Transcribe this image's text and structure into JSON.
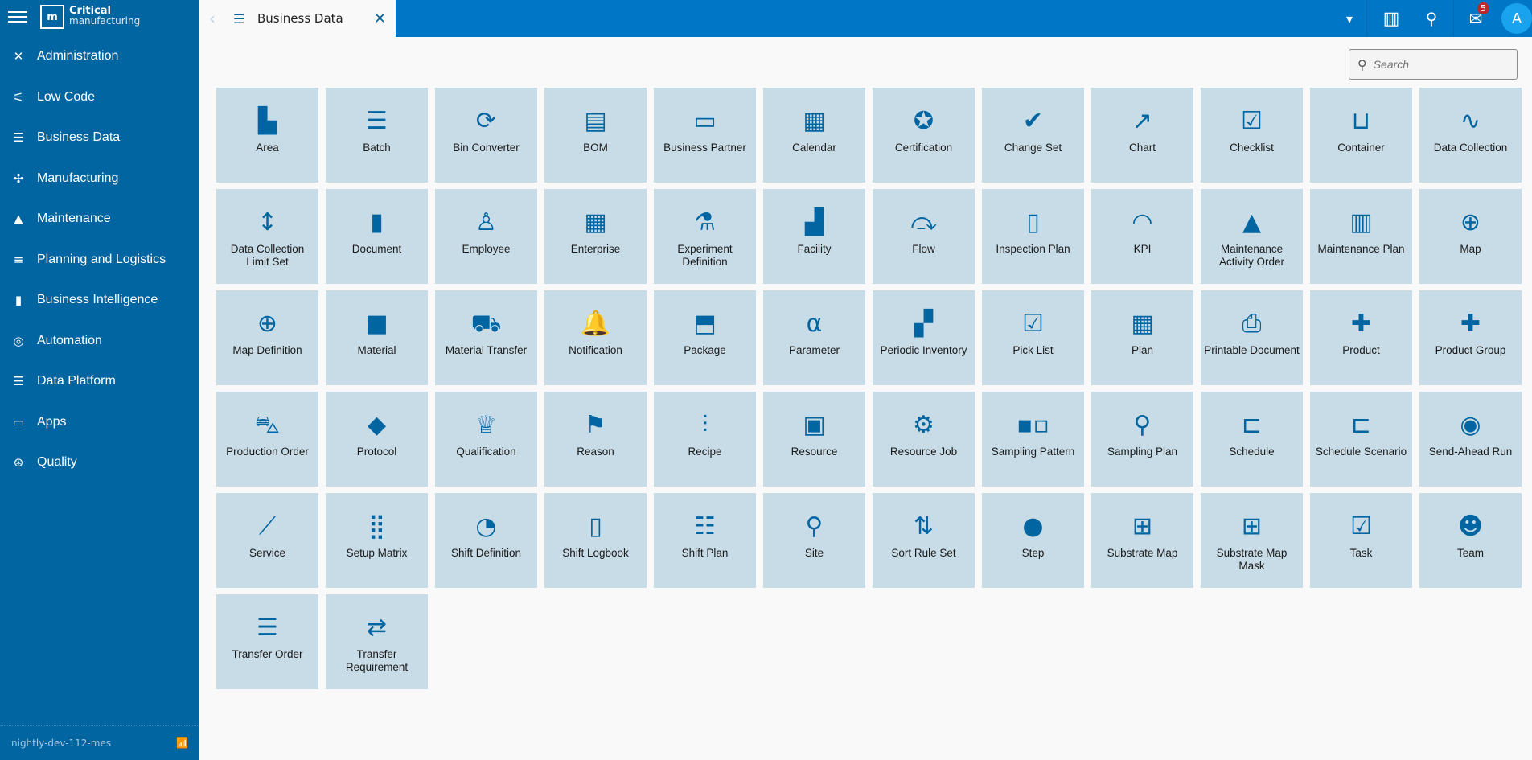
{
  "app": {
    "logo_top": "Critical",
    "logo_bottom": "manufacturing",
    "logo_mark": "m",
    "env": "nightly-dev-112-mes"
  },
  "sidebar": {
    "items": [
      {
        "label": "Administration",
        "icon": "✕"
      },
      {
        "label": "Low Code",
        "icon": "⚟"
      },
      {
        "label": "Business Data",
        "icon": "☰"
      },
      {
        "label": "Manufacturing",
        "icon": "✣"
      },
      {
        "label": "Maintenance",
        "icon": "▲"
      },
      {
        "label": "Planning and Logistics",
        "icon": "≡"
      },
      {
        "label": "Business Intelligence",
        "icon": "▮"
      },
      {
        "label": "Automation",
        "icon": "◎"
      },
      {
        "label": "Data Platform",
        "icon": "☰"
      },
      {
        "label": "Apps",
        "icon": "▭"
      },
      {
        "label": "Quality",
        "icon": "⊛"
      }
    ]
  },
  "tab": {
    "title": "Business Data",
    "back": "‹",
    "icon": "☰",
    "close": "✕"
  },
  "toolbar": {
    "dropdown": "▾",
    "barcode": "▥",
    "search": "⚲",
    "chat": "✉",
    "notifications": "5",
    "avatar": "A"
  },
  "search": {
    "placeholder": "Search",
    "icon": "⚲"
  },
  "tiles": [
    {
      "label": "Area",
      "icon": "▙"
    },
    {
      "label": "Batch",
      "icon": "☰"
    },
    {
      "label": "Bin Converter",
      "icon": "⟳"
    },
    {
      "label": "BOM",
      "icon": "▤"
    },
    {
      "label": "Business Partner",
      "icon": "▭"
    },
    {
      "label": "Calendar",
      "icon": "▦"
    },
    {
      "label": "Certification",
      "icon": "✪"
    },
    {
      "label": "Change Set",
      "icon": "✔"
    },
    {
      "label": "Chart",
      "icon": "↗"
    },
    {
      "label": "Checklist",
      "icon": "☑"
    },
    {
      "label": "Container",
      "icon": "⊔"
    },
    {
      "label": "Data Collection",
      "icon": "∿"
    },
    {
      "label": "Data Collection Limit Set",
      "icon": "↕"
    },
    {
      "label": "Document",
      "icon": "▮"
    },
    {
      "label": "Employee",
      "icon": "♙"
    },
    {
      "label": "Enterprise",
      "icon": "▦"
    },
    {
      "label": "Experiment Definition",
      "icon": "⚗"
    },
    {
      "label": "Facility",
      "icon": "▟"
    },
    {
      "label": "Flow",
      "icon": "⤼"
    },
    {
      "label": "Inspection Plan",
      "icon": "▯"
    },
    {
      "label": "KPI",
      "icon": "◠"
    },
    {
      "label": "Maintenance Activity Order",
      "icon": "▲"
    },
    {
      "label": "Maintenance Plan",
      "icon": "▥"
    },
    {
      "label": "Map",
      "icon": "⊕"
    },
    {
      "label": "Map Definition",
      "icon": "⊕"
    },
    {
      "label": "Material",
      "icon": "■"
    },
    {
      "label": "Material Transfer",
      "icon": "⛟"
    },
    {
      "label": "Notification",
      "icon": "🔔"
    },
    {
      "label": "Package",
      "icon": "⬒"
    },
    {
      "label": "Parameter",
      "icon": "α"
    },
    {
      "label": "Periodic Inventory",
      "icon": "▞"
    },
    {
      "label": "Pick List",
      "icon": "☑"
    },
    {
      "label": "Plan",
      "icon": "▦"
    },
    {
      "label": "Printable Document",
      "icon": "⎙"
    },
    {
      "label": "Product",
      "icon": "✚"
    },
    {
      "label": "Product Group",
      "icon": "✚"
    },
    {
      "label": "Production Order",
      "icon": "⛍"
    },
    {
      "label": "Protocol",
      "icon": "◆"
    },
    {
      "label": "Qualification",
      "icon": "♕"
    },
    {
      "label": "Reason",
      "icon": "⚑"
    },
    {
      "label": "Recipe",
      "icon": "⫶"
    },
    {
      "label": "Resource",
      "icon": "▣"
    },
    {
      "label": "Resource Job",
      "icon": "⚙"
    },
    {
      "label": "Sampling Pattern",
      "icon": "▪▫"
    },
    {
      "label": "Sampling Plan",
      "icon": "⚲"
    },
    {
      "label": "Schedule",
      "icon": "⊏"
    },
    {
      "label": "Schedule Scenario",
      "icon": "⊏"
    },
    {
      "label": "Send-Ahead Run",
      "icon": "◉"
    },
    {
      "label": "Service",
      "icon": "⟋"
    },
    {
      "label": "Setup Matrix",
      "icon": "⣿"
    },
    {
      "label": "Shift Definition",
      "icon": "◔"
    },
    {
      "label": "Shift Logbook",
      "icon": "▯"
    },
    {
      "label": "Shift Plan",
      "icon": "☷"
    },
    {
      "label": "Site",
      "icon": "⚲"
    },
    {
      "label": "Sort Rule Set",
      "icon": "⇅"
    },
    {
      "label": "Step",
      "icon": "●"
    },
    {
      "label": "Substrate Map",
      "icon": "⊞"
    },
    {
      "label": "Substrate Map Mask",
      "icon": "⊞"
    },
    {
      "label": "Task",
      "icon": "☑"
    },
    {
      "label": "Team",
      "icon": "☻"
    },
    {
      "label": "Transfer Order",
      "icon": "☰"
    },
    {
      "label": "Transfer Requirement",
      "icon": "⇄"
    }
  ],
  "colors": {
    "sidebar": "#0065a1",
    "topbar": "#0077c6",
    "tile": "#c8dce7",
    "icon": "#0065a1"
  }
}
